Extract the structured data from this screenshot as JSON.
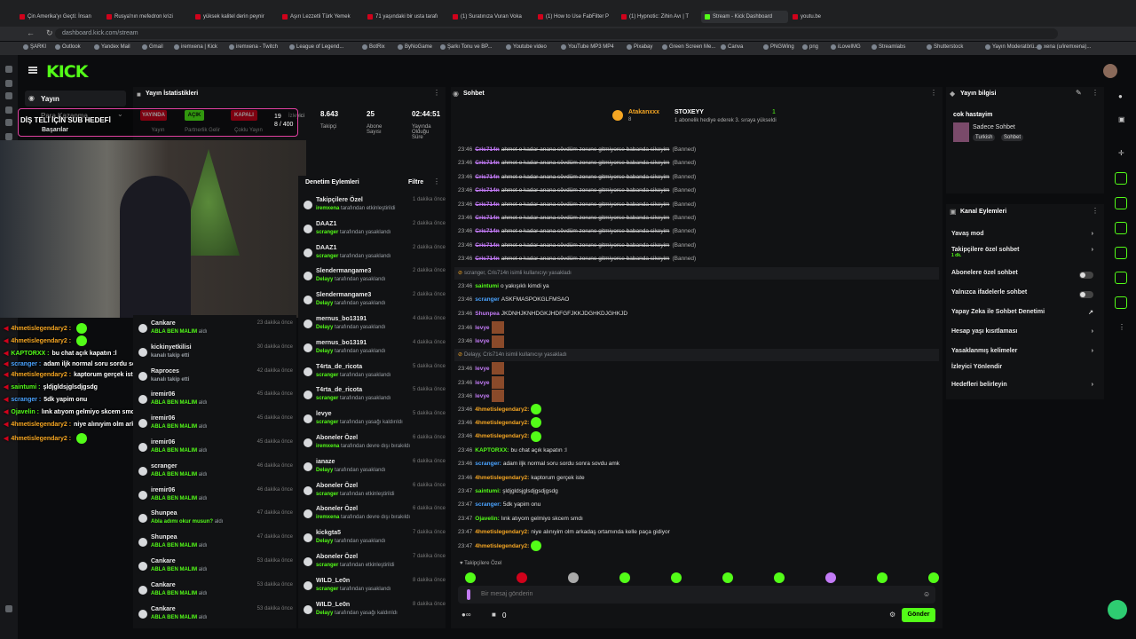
{
  "browser": {
    "tabs": [
      {
        "label": "Çin Amerika'yı Geçti: İnsan"
      },
      {
        "label": "Rusya'nın mefedron krizi"
      },
      {
        "label": "yüksek kalitel derin peynir"
      },
      {
        "label": "Aşırı Lezzetli Türk Yemek"
      },
      {
        "label": "71 yaşındaki bir usta tarafı"
      },
      {
        "label": "(1) Suratınıza Vuran Voka"
      },
      {
        "label": "(1) How to Use FabFilter P"
      },
      {
        "label": "(1) Hypnotic: Zihin Avı | T"
      },
      {
        "label": "Stream - Kick Dashboard"
      },
      {
        "label": "youtu.be"
      }
    ],
    "url": "dashboard.kick.com/stream",
    "bookmarks": [
      "ŞARKI",
      "Outlook",
      "Yandex Mail",
      "Gmail",
      "iremxena | Kick",
      "iremxena - Twitch",
      "League of Legend...",
      "BotRix",
      "ByNoGame",
      "Şarkı Tonu ve BP...",
      "Youtube video",
      "YouTube MP3 MP4",
      "Pixabay",
      "Green Screen Me...",
      "Canva",
      "PNGWing",
      "png",
      "iLoveIMG",
      "Streamlabs",
      "Shutterstock",
      "Yayın Moderatörü...",
      "xena (u/iremxena)..."
    ]
  },
  "kick": {
    "logo": "KICK"
  },
  "nav": {
    "stream": "Yayın",
    "earn": "Para Kazanma",
    "achievements": "Başarılar"
  },
  "stream_overlay": {
    "goal_text": "DİŞ TELİ İÇİN SUB HEDEFİ",
    "goal_count": "19\n8 / 400"
  },
  "stats": {
    "title": "Yayın İstatistikleri",
    "badges": [
      {
        "label": "YAYINDA",
        "color": "#d0021b"
      },
      {
        "label": "AÇIK",
        "color": "#53fc18"
      },
      {
        "label": "KAPALI",
        "color": "#d0021b"
      }
    ],
    "badge_labels": [
      "Yayın",
      "Partnerlik Gelir",
      "Çoklu Yayın"
    ],
    "viewers_label": "İzleyici",
    "followers": "8.643",
    "followers_label": "Takipçi",
    "subs": "25",
    "subs_label": "Abone Sayısı",
    "uptime": "02:44:51",
    "uptime_label": "Yayında Olduğu Süre"
  },
  "audit": {
    "title": "Denetim Eylemleri",
    "filter": "Filtre",
    "rows": [
      {
        "name": "Takipçilere Özel",
        "sub": "iremxena",
        "action": "tarafından etkinleştirildi",
        "time": "1 dakika önce"
      },
      {
        "name": "DAAZ1",
        "sub": "scranger",
        "action": "tarafından yasaklandı",
        "time": "2 dakika önce"
      },
      {
        "name": "DAAZ1",
        "sub": "scranger",
        "action": "tarafından yasaklandı",
        "time": "2 dakika önce"
      },
      {
        "name": "Slendermangame3",
        "sub": "Delayy",
        "action": "tarafından yasaklandı",
        "time": "2 dakika önce"
      },
      {
        "name": "Slendermangame3",
        "sub": "Delayy",
        "action": "tarafından yasaklandı",
        "time": "2 dakika önce"
      },
      {
        "name": "mernus_bo13191",
        "sub": "Delayy",
        "action": "tarafından yasaklandı",
        "time": "4 dakika önce"
      },
      {
        "name": "mernus_bo13191",
        "sub": "Delayy",
        "action": "tarafından yasaklandı",
        "time": "4 dakika önce"
      },
      {
        "name": "T4rta_de_ricota",
        "sub": "scranger",
        "action": "tarafından yasaklandı",
        "time": "5 dakika önce"
      },
      {
        "name": "T4rta_de_ricota",
        "sub": "scranger",
        "action": "tarafından yasaklandı",
        "time": "5 dakika önce"
      },
      {
        "name": "levye",
        "sub": "scranger",
        "action": "tarafından yasağı kaldırıldı",
        "time": "5 dakika önce"
      },
      {
        "name": "Aboneler Özel",
        "sub": "iremxena",
        "action": "tarafından devre dışı bırakıldı",
        "time": "6 dakika önce"
      },
      {
        "name": "ianaze",
        "sub": "Delayy",
        "action": "tarafından yasaklandı",
        "time": "6 dakika önce"
      },
      {
        "name": "Aboneler Özel",
        "sub": "scranger",
        "action": "tarafından etkinleştirildi",
        "time": "6 dakika önce"
      },
      {
        "name": "Aboneler Özel",
        "sub": "iremxena",
        "action": "tarafından devre dışı bırakıldı",
        "time": "6 dakika önce"
      },
      {
        "name": "kickgta5",
        "sub": "Delayy",
        "action": "tarafından yasaklandı",
        "time": "7 dakika önce"
      },
      {
        "name": "Aboneler Özel",
        "sub": "scranger",
        "action": "tarafından etkinleştirildi",
        "time": "7 dakika önce"
      },
      {
        "name": "WILD_Le0n",
        "sub": "scranger",
        "action": "tarafından yasaklandı",
        "time": "8 dakika önce"
      },
      {
        "name": "WILD_Le0n",
        "sub": "Delayy",
        "action": "tarafından yasağı kaldırıldı",
        "time": "8 dakika önce"
      }
    ]
  },
  "follows": {
    "rows": [
      {
        "name": "Cankare",
        "sub": "ABLA BEN MALIM",
        "tail": "aldı",
        "time": "23 dakika önce"
      },
      {
        "name": "kickinyetkilisi",
        "sub": "kanalı takip etti",
        "tail": "",
        "time": "30 dakika önce"
      },
      {
        "name": "Raproces",
        "sub": "kanalı takip etti",
        "tail": "",
        "time": "42 dakika önce"
      },
      {
        "name": "iremir06",
        "sub": "ABLA BEN MALIM",
        "tail": "aldı",
        "time": "45 dakika önce"
      },
      {
        "name": "iremir06",
        "sub": "ABLA BEN MALIM",
        "tail": "aldı",
        "time": "45 dakika önce"
      },
      {
        "name": "iremir06",
        "sub": "ABLA BEN MALIM",
        "tail": "aldı",
        "time": "45 dakika önce"
      },
      {
        "name": "scranger",
        "sub": "ABLA BEN MALIM",
        "tail": "aldı",
        "time": "46 dakika önce"
      },
      {
        "name": "iremir06",
        "sub": "ABLA BEN MALIM",
        "tail": "aldı",
        "time": "46 dakika önce"
      },
      {
        "name": "Shunpea",
        "sub": "Abla adımı okur musun?",
        "tail": "aldı",
        "time": "47 dakika önce"
      },
      {
        "name": "Shunpea",
        "sub": "ABLA BEN MALIM",
        "tail": "aldı",
        "time": "47 dakika önce"
      },
      {
        "name": "Cankare",
        "sub": "ABLA BEN MALIM",
        "tail": "aldı",
        "time": "53 dakika önce"
      },
      {
        "name": "Cankare",
        "sub": "ABLA BEN MALIM",
        "tail": "aldı",
        "time": "53 dakika önce"
      },
      {
        "name": "Cankare",
        "sub": "ABLA BEN MALIM",
        "tail": "aldı",
        "time": "53 dakika önce"
      }
    ]
  },
  "overlay_chat": [
    {
      "user": "4hmetislegendary2 :",
      "text": "",
      "color": "#f5a623"
    },
    {
      "user": "4hmetislegendary2 :",
      "text": "",
      "color": "#f5a623"
    },
    {
      "user": "KAPTORXX :",
      "text": "bu chat açık kapatın :l",
      "color": "#53fc18"
    },
    {
      "user": "scranger :",
      "text": "adam iljk normal soru sordu sonra sovdu amk",
      "color": "#4aa3ff"
    },
    {
      "user": "4hmetislegendary2 :",
      "text": "kaptorum gerçek iste",
      "color": "#f5a623"
    },
    {
      "user": "saintumi :",
      "text": "şldjgldsjglsdjgsdg",
      "color": "#53fc18"
    },
    {
      "user": "scranger :",
      "text": "5dk yapim onu",
      "color": "#4aa3ff"
    },
    {
      "user": "Ojavelin :",
      "text": "lınk atıyom gelmiyo skcem smdı",
      "color": "#53fc18"
    },
    {
      "user": "4hmetislegendary2 :",
      "text": "niye alınıyim olm arkadaş ortamında kelle paça gidiyor",
      "color": "#f5a623"
    },
    {
      "user": "4hmetislegendary2 :",
      "text": "",
      "color": "#f5a623"
    }
  ],
  "chat": {
    "title": "Sohbet",
    "pinned_user": "Atakanxxx",
    "pinned_target": "STOXEYY",
    "pinned_count": "8",
    "pinned_text": "1 abonelik hediye ederek 3. sıraya yükseldi",
    "pinned_right": "1",
    "banned_text": "ahmet o kadar anana sövdüm zorune gitmiyorse babanda sikeyim",
    "banned_tag": "(Banned)",
    "banned_users": [
      "Cris714n",
      "Cris714n",
      "Cris714n",
      "Cris714n",
      "Cris714n",
      "Cris714n",
      "Cris714n",
      "Cris714n",
      "Cris714n"
    ],
    "banned_time": "23:46",
    "messages": [
      {
        "kind": "sys",
        "text": "scranger, Cris714n isimli kullanıcıyı yasakladı",
        "time": "23:46"
      },
      {
        "kind": "msg",
        "time": "23:46",
        "user": "saintumi",
        "text": "o yakışıklı kimdi ya",
        "color": "#53fc18"
      },
      {
        "kind": "msg",
        "time": "23:46",
        "user": "scranger",
        "text": "ASKFMASPOKGLFMSAO",
        "color": "#4aa3ff"
      },
      {
        "kind": "msg",
        "time": "23:46",
        "user": "Shunpea",
        "text": "JKDNHJKNHDGKJHDFGFJKKJDGHKDJGHKJD",
        "color": "#c37bf6"
      },
      {
        "kind": "img",
        "time": "23:46",
        "user": "levye",
        "text": "",
        "color": "#c37bf6"
      },
      {
        "kind": "img",
        "time": "23:46",
        "user": "levye",
        "text": "",
        "color": "#c37bf6"
      },
      {
        "kind": "sys",
        "text": "Delayy, Cris714n isimli kullanıcıyı yasakladı",
        "time": "23:46"
      },
      {
        "kind": "img",
        "time": "23:46",
        "user": "levye",
        "text": "",
        "color": "#c37bf6"
      },
      {
        "kind": "img",
        "time": "23:46",
        "user": "levye",
        "text": "",
        "color": "#c37bf6"
      },
      {
        "kind": "img",
        "time": "23:46",
        "user": "levye",
        "text": "",
        "color": "#c37bf6"
      },
      {
        "kind": "emote",
        "time": "23:46",
        "user": "4hmetislegendary2:",
        "text": "",
        "color": "#f5a623"
      },
      {
        "kind": "emote",
        "time": "23:46",
        "user": "4hmetislegendary2:",
        "text": "",
        "color": "#f5a623"
      },
      {
        "kind": "emote",
        "time": "23:46",
        "user": "4hmetislegendary2:",
        "text": "",
        "color": "#f5a623"
      },
      {
        "kind": "msg",
        "time": "23:46",
        "user": "KAPTORXX:",
        "text": "bu chat açık kapatın :l",
        "color": "#53fc18"
      },
      {
        "kind": "msg",
        "time": "23:46",
        "user": "scranger:",
        "text": "adam iljk normal soru sordu sonra sovdu amk",
        "color": "#4aa3ff"
      },
      {
        "kind": "msg",
        "time": "23:46",
        "user": "4hmetislegendary2:",
        "text": "kaptorum gerçek iste",
        "color": "#f5a623"
      },
      {
        "kind": "msg",
        "time": "23:47",
        "user": "saintumi:",
        "text": "şldjgldsjglsdjgsdjgsdg",
        "color": "#53fc18"
      },
      {
        "kind": "msg",
        "time": "23:47",
        "user": "scranger:",
        "text": "5dk yapim onu",
        "color": "#4aa3ff"
      },
      {
        "kind": "msg",
        "time": "23:47",
        "user": "Ojavelin:",
        "text": "lınk atıyom gelmiyo skcem smdı",
        "color": "#53fc18"
      },
      {
        "kind": "msg",
        "time": "23:47",
        "user": "4hmetislegendary2:",
        "text": "niye alınıyim olm arkadaş ortamında kelle paça gidiyor",
        "color": "#f5a623"
      },
      {
        "kind": "emote",
        "time": "23:47",
        "user": "4hmetislegendary2:",
        "text": "",
        "color": "#f5a623"
      }
    ],
    "followers_only": "Takipçilere Özel",
    "input_placeholder": "Bir mesaj gönderin",
    "count": "0",
    "send": "Gönder"
  },
  "info": {
    "title": "Yayın bilgisi",
    "stream_title": "cok hastayim",
    "category": "Sadece Sohbet",
    "tags": [
      "Turkish",
      "Sohbet"
    ]
  },
  "actions": {
    "title": "Kanal Eylemleri",
    "items": [
      {
        "label": "Yavaş mod",
        "control": "chevron"
      },
      {
        "label": "Takipçilere özel sohbet",
        "control": "chevron",
        "sub": "1 dk."
      },
      {
        "label": "Abonelere özel sohbet",
        "control": "toggle"
      },
      {
        "label": "Yalnızca ifadelerle sohbet",
        "control": "toggle"
      },
      {
        "label": "Yapay Zeka ile Sohbet Denetimi",
        "control": "external"
      },
      {
        "label": "Hesap yaşı kısıtlaması",
        "control": "chevron"
      },
      {
        "label": "Yasaklanmış kelimeler",
        "control": "chevron"
      },
      {
        "label": "İzleyici Yönlendir",
        "control": "none"
      },
      {
        "label": "Hedefleri belirleyin",
        "control": "chevron"
      }
    ]
  },
  "colors": {
    "accent": "#53fc18",
    "live": "#d0021b"
  }
}
